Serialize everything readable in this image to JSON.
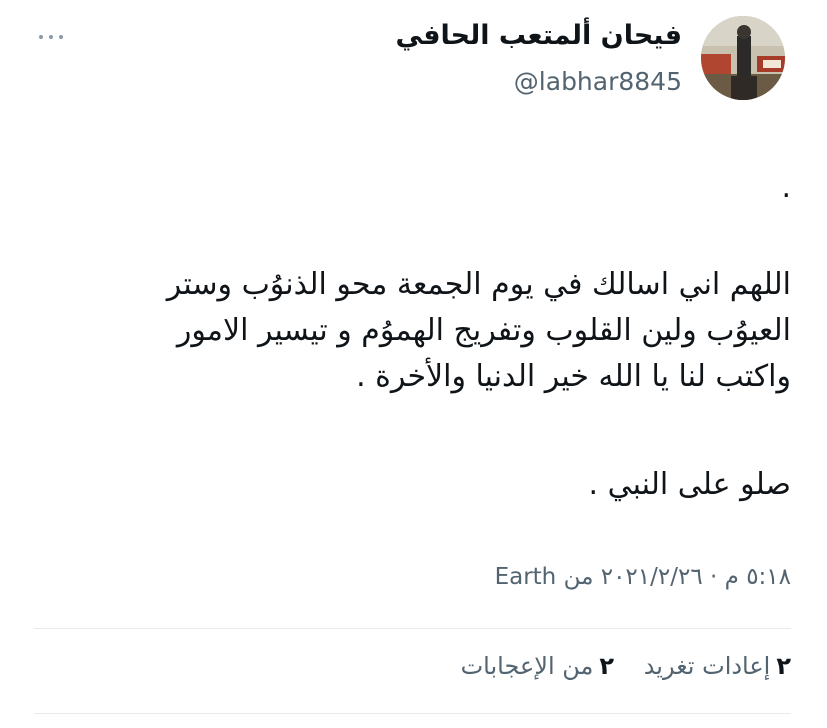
{
  "author": {
    "display_name": "فيحان ألمتعب الحافي",
    "handle": "@labhar8845"
  },
  "tweet": {
    "dot": ".",
    "lines": [
      "اللهم اني اسالك في يوم الجمعة محو الذنوُب وستر",
      "العيوُب ولين القلوب وتفريج الهموُم و تيسير الامور",
      "واكتب لنا يا الله خير الدنيا والأخرة  ."
    ],
    "closing": "صلو على النبي ."
  },
  "meta": {
    "timestamp": "٥:١٨ م · ٢٠٢١/٢/٢٦",
    "source": "من Earth"
  },
  "stats": {
    "retweets": {
      "count": "٢",
      "label": "إعادات تغريد"
    },
    "likes": {
      "count": "٢",
      "label": "من الإعجابات"
    }
  },
  "colors": {
    "text": "#0f1419",
    "secondary": "#536471",
    "divider": "#e6eaec"
  },
  "icons": {
    "more": "more-horizontal-icon"
  }
}
